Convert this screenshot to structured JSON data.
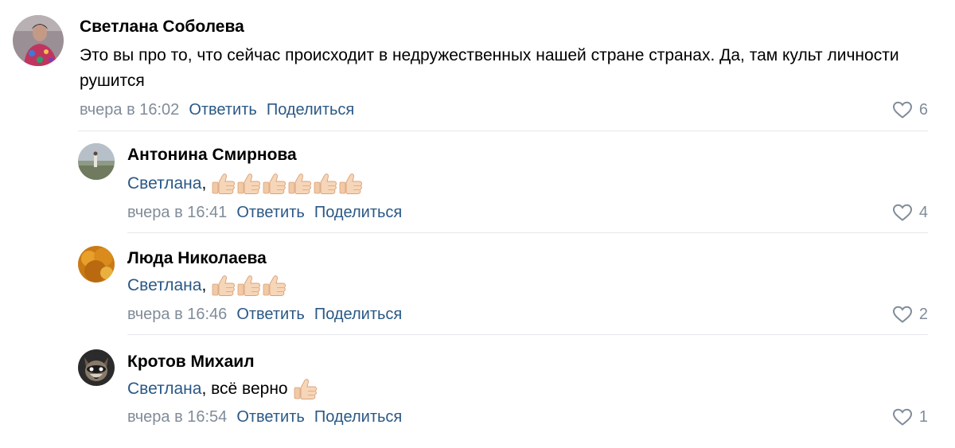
{
  "comments": [
    {
      "author": "Светлана Соболева",
      "text": "Это вы про то, что сейчас происходит в недружественных нашей стране странах. Да, там культ личности рушится",
      "date": "вчера в 16:02",
      "reply_label": "Ответить",
      "share_label": "Поделиться",
      "likes": "6"
    },
    {
      "author": "Антонина Смирнова",
      "mention": "Светлана",
      "text": ",",
      "emoji": "thumbs-up-icon",
      "emoji_count": 6,
      "date": "вчера в 16:41",
      "reply_label": "Ответить",
      "share_label": "Поделиться",
      "likes": "4"
    },
    {
      "author": "Люда Николаева",
      "mention": "Светлана",
      "text": ",",
      "emoji": "thumbs-up-icon",
      "emoji_count": 3,
      "date": "вчера в 16:46",
      "reply_label": "Ответить",
      "share_label": "Поделиться",
      "likes": "2"
    },
    {
      "author": "Кротов Михаил",
      "mention": "Светлана",
      "text": ", всё верно",
      "emoji": "thumbs-up-icon",
      "emoji_count": 1,
      "date": "вчера в 16:54",
      "reply_label": "Ответить",
      "share_label": "Поделиться",
      "likes": "1"
    }
  ],
  "colors": {
    "link": "#2a5885",
    "meta": "#818c99",
    "divider": "#e7e8ec"
  }
}
